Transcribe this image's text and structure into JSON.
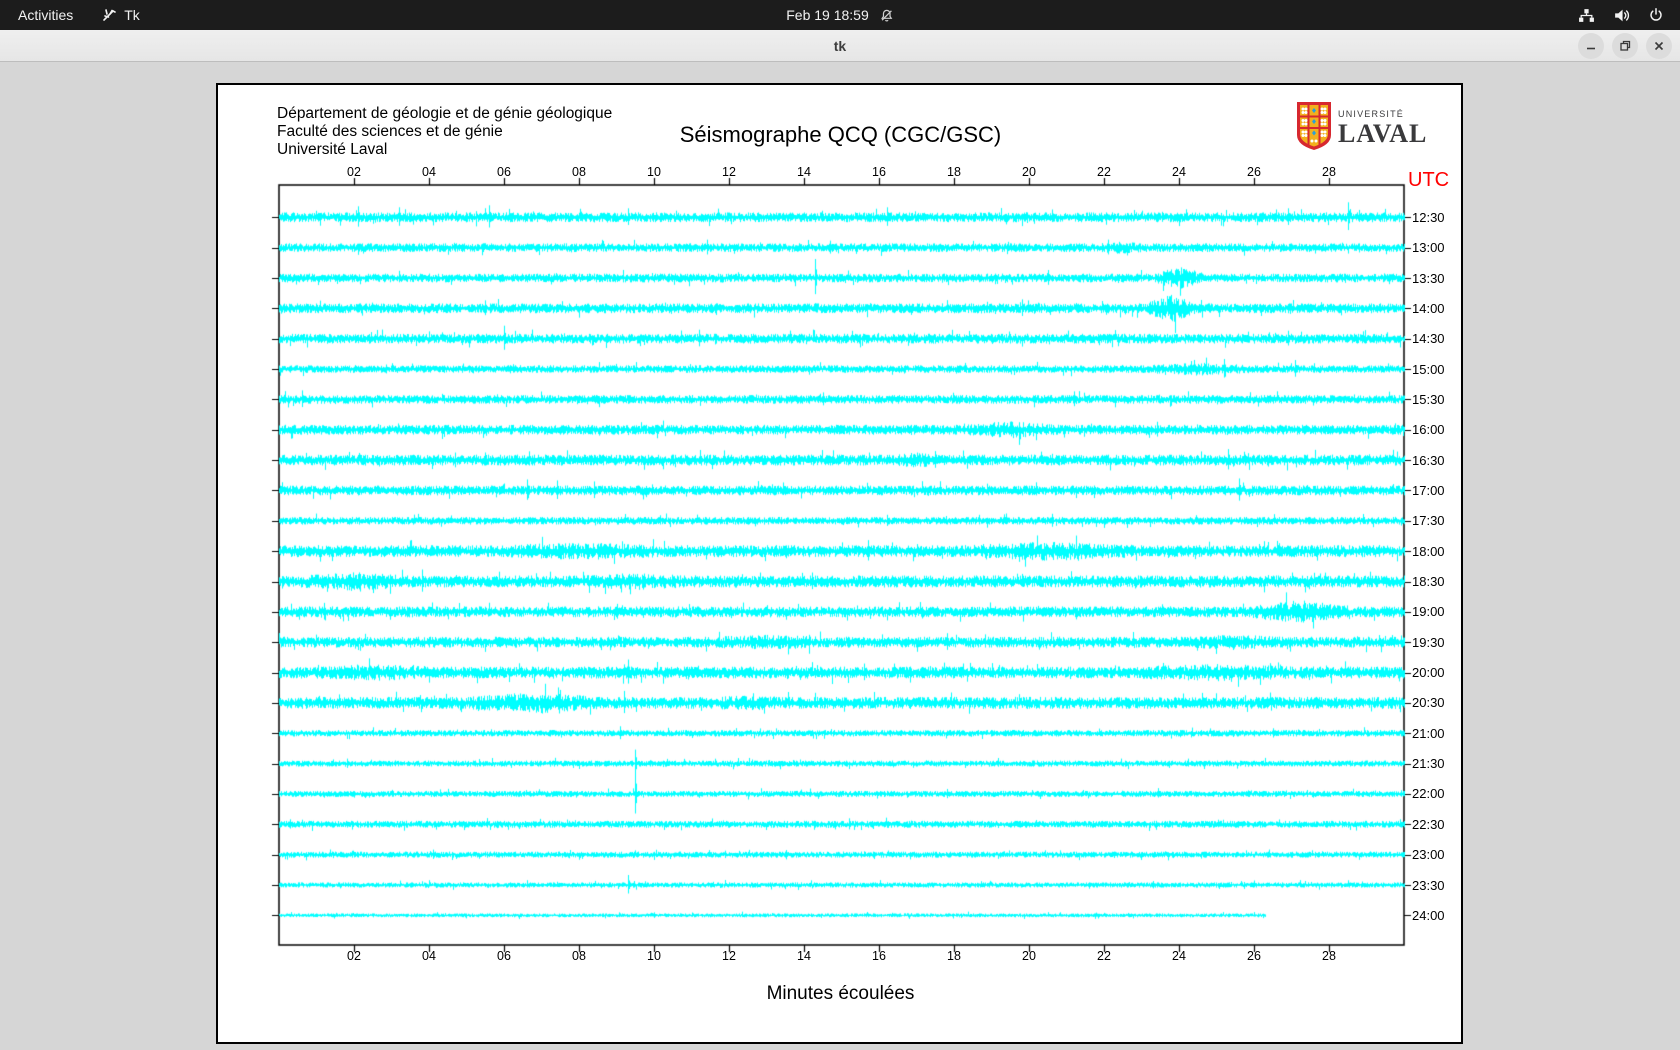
{
  "top_bar": {
    "activities_label": "Activities",
    "app_name": "Tk",
    "clock": "Feb 19 18:59",
    "icons": [
      "notifications-off-icon",
      "network-icon",
      "volume-icon",
      "power-icon"
    ]
  },
  "window": {
    "title": "tk",
    "controls": [
      "minimize",
      "maximize",
      "close"
    ]
  },
  "header": {
    "line1": "Département de géologie et de génie géologique",
    "line2": "Faculté des sciences et de génie",
    "line3": "Université Laval",
    "logo_small": "UNIVERSITÉ",
    "logo_large": "LAVAL"
  },
  "colors": {
    "trace": "#00ffff",
    "utc_label": "#ff0000",
    "axis": "#000000",
    "logo_red": "#d7282f",
    "logo_yellow": "#f2b01e",
    "logo_blue": "#2a9fd8"
  },
  "chart_data": {
    "type": "line",
    "subtype": "helicorder-seismogram",
    "title": "Séismographe QCQ (CGC/GSC)",
    "xlabel": "Minutes écoulées",
    "right_axis_label": "UTC",
    "x_range_minutes": [
      0,
      30
    ],
    "x_ticks": [
      "02",
      "04",
      "06",
      "08",
      "10",
      "12",
      "14",
      "16",
      "18",
      "20",
      "22",
      "24",
      "26",
      "28"
    ],
    "x_tick_minutes": [
      2,
      4,
      6,
      8,
      10,
      12,
      14,
      16,
      18,
      20,
      22,
      24,
      26,
      28
    ],
    "trace_color": "#00ffff",
    "rows": [
      {
        "label": "12:30",
        "amp": 4.5,
        "end": 30,
        "bursts": [],
        "spikes": [
          [
            2.1,
            11
          ],
          [
            3.2,
            10
          ],
          [
            5.6,
            12
          ],
          [
            9.3,
            9
          ],
          [
            16.2,
            10
          ],
          [
            26.9,
            9
          ],
          [
            28.5,
            15
          ]
        ]
      },
      {
        "label": "13:00",
        "amp": 4.0,
        "end": 30,
        "bursts": [
          [
            21.5,
            23.5,
            6
          ]
        ],
        "spikes": [
          [
            11.4,
            8
          ],
          [
            14.7,
            7
          ],
          [
            22.1,
            8
          ]
        ]
      },
      {
        "label": "13:30",
        "amp": 4.0,
        "end": 30,
        "bursts": [
          [
            23.4,
            24.6,
            11
          ]
        ],
        "spikes": [
          [
            14.3,
            19
          ],
          [
            20.5,
            8
          ]
        ]
      },
      {
        "label": "14:00",
        "amp": 4.5,
        "end": 30,
        "bursts": [
          [
            23.2,
            24.4,
            13
          ]
        ],
        "spikes": [
          [
            5.5,
            8
          ],
          [
            19.8,
            9
          ]
        ]
      },
      {
        "label": "14:30",
        "amp": 4.5,
        "end": 30,
        "bursts": [],
        "spikes": [
          [
            6.0,
            13
          ],
          [
            11.2,
            9
          ],
          [
            26.9,
            8
          ]
        ]
      },
      {
        "label": "15:00",
        "amp": 3.5,
        "end": 30,
        "bursts": [
          [
            22.5,
            26.5,
            6
          ]
        ],
        "spikes": [
          [
            25.2,
            10
          ],
          [
            27.1,
            9
          ]
        ]
      },
      {
        "label": "15:30",
        "amp": 4.0,
        "end": 30,
        "bursts": [],
        "spikes": [
          [
            0.6,
            9
          ],
          [
            14.5,
            7
          ],
          [
            21.2,
            8
          ]
        ]
      },
      {
        "label": "16:00",
        "amp": 4.5,
        "end": 30,
        "bursts": [
          [
            17.8,
            21.2,
            8
          ]
        ],
        "spikes": [
          [
            23.4,
            8
          ]
        ]
      },
      {
        "label": "16:30",
        "amp": 5.0,
        "end": 30,
        "bursts": [
          [
            15.8,
            18.2,
            7
          ]
        ],
        "spikes": [
          [
            17.5,
            9
          ],
          [
            25.3,
            11
          ]
        ]
      },
      {
        "label": "17:00",
        "amp": 4.5,
        "end": 30,
        "bursts": [],
        "spikes": [
          [
            6.6,
            11
          ],
          [
            7.4,
            10
          ],
          [
            8.4,
            9
          ],
          [
            25.6,
            12
          ]
        ]
      },
      {
        "label": "17:30",
        "amp": 3.5,
        "end": 30,
        "bursts": [],
        "spikes": [
          [
            16.2,
            6
          ],
          [
            20.6,
            7
          ]
        ]
      },
      {
        "label": "18:00",
        "amp": 5.5,
        "end": 30,
        "bursts": [
          [
            4,
            12,
            8
          ],
          [
            17,
            24,
            9
          ]
        ],
        "spikes": [
          [
            15.7,
            11
          ]
        ]
      },
      {
        "label": "18:30",
        "amp": 5.5,
        "end": 30,
        "bursts": [
          [
            0,
            4,
            9
          ],
          [
            7,
            12,
            8
          ]
        ],
        "spikes": [
          [
            3.8,
            12
          ],
          [
            14.2,
            9
          ]
        ]
      },
      {
        "label": "19:00",
        "amp": 5.0,
        "end": 30,
        "bursts": [
          [
            25.8,
            28.6,
            11
          ]
        ],
        "spikes": [
          [
            1.2,
            9
          ],
          [
            9.0,
            8
          ]
        ]
      },
      {
        "label": "19:30",
        "amp": 5.0,
        "end": 30,
        "bursts": [
          [
            10,
            16,
            7
          ],
          [
            23,
            28,
            7
          ]
        ],
        "spikes": [
          [
            17.8,
            9
          ]
        ]
      },
      {
        "label": "20:00",
        "amp": 5.5,
        "end": 30,
        "bursts": [
          [
            0,
            5,
            8
          ],
          [
            21,
            29,
            8
          ]
        ],
        "spikes": [
          [
            9.3,
            13
          ],
          [
            15.6,
            9
          ]
        ]
      },
      {
        "label": "20:30",
        "amp": 5.5,
        "end": 30,
        "bursts": [
          [
            4.5,
            9,
            10
          ],
          [
            10,
            15,
            7
          ]
        ],
        "spikes": [
          [
            9.2,
            12
          ]
        ]
      },
      {
        "label": "21:00",
        "amp": 3.0,
        "end": 30,
        "bursts": [],
        "spikes": [
          [
            9.1,
            7
          ],
          [
            26.5,
            5
          ]
        ]
      },
      {
        "label": "21:30",
        "amp": 2.8,
        "end": 30,
        "bursts": [],
        "spikes": [
          [
            1.8,
            5
          ],
          [
            9.5,
            14
          ]
        ]
      },
      {
        "label": "22:00",
        "amp": 2.8,
        "end": 30,
        "bursts": [],
        "spikes": [
          [
            9.5,
            23
          ],
          [
            17.8,
            5
          ]
        ]
      },
      {
        "label": "22:30",
        "amp": 3.2,
        "end": 30,
        "bursts": [],
        "spikes": [
          [
            0.3,
            5
          ],
          [
            15.2,
            6
          ]
        ]
      },
      {
        "label": "23:00",
        "amp": 2.8,
        "end": 30,
        "bursts": [],
        "spikes": [
          [
            4.1,
            5
          ],
          [
            11.9,
            4
          ]
        ]
      },
      {
        "label": "23:30",
        "amp": 2.4,
        "end": 30,
        "bursts": [],
        "spikes": [
          [
            9.3,
            10
          ],
          [
            23.3,
            4
          ]
        ]
      },
      {
        "label": "24:00",
        "amp": 1.8,
        "end": 26.3,
        "bursts": [],
        "spikes": [
          [
            10.0,
            3
          ]
        ]
      }
    ]
  }
}
